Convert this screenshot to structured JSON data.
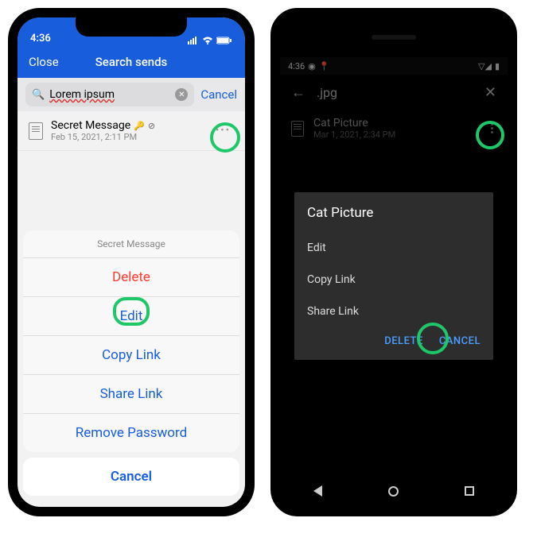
{
  "ios": {
    "status_time": "4:36",
    "nav_close": "Close",
    "nav_title": "Search sends",
    "search_text": "Lorem ipsum",
    "search_cancel": "Cancel",
    "item": {
      "name": "Secret Message",
      "date": "Feb 15, 2021, 2:11 PM"
    },
    "sheet": {
      "title": "Secret Message",
      "delete": "Delete",
      "edit": "Edit",
      "copy": "Copy Link",
      "share": "Share Link",
      "remove_pw": "Remove Password",
      "cancel": "Cancel"
    }
  },
  "android": {
    "status_time": "4:36",
    "header_title": ".jpg",
    "item": {
      "name": "Cat Picture",
      "date": "Mar 1, 2021, 2:34 PM"
    },
    "dialog": {
      "title": "Cat Picture",
      "edit": "Edit",
      "copy": "Copy Link",
      "share": "Share Link",
      "delete": "DELETE",
      "cancel": "CANCEL"
    }
  }
}
